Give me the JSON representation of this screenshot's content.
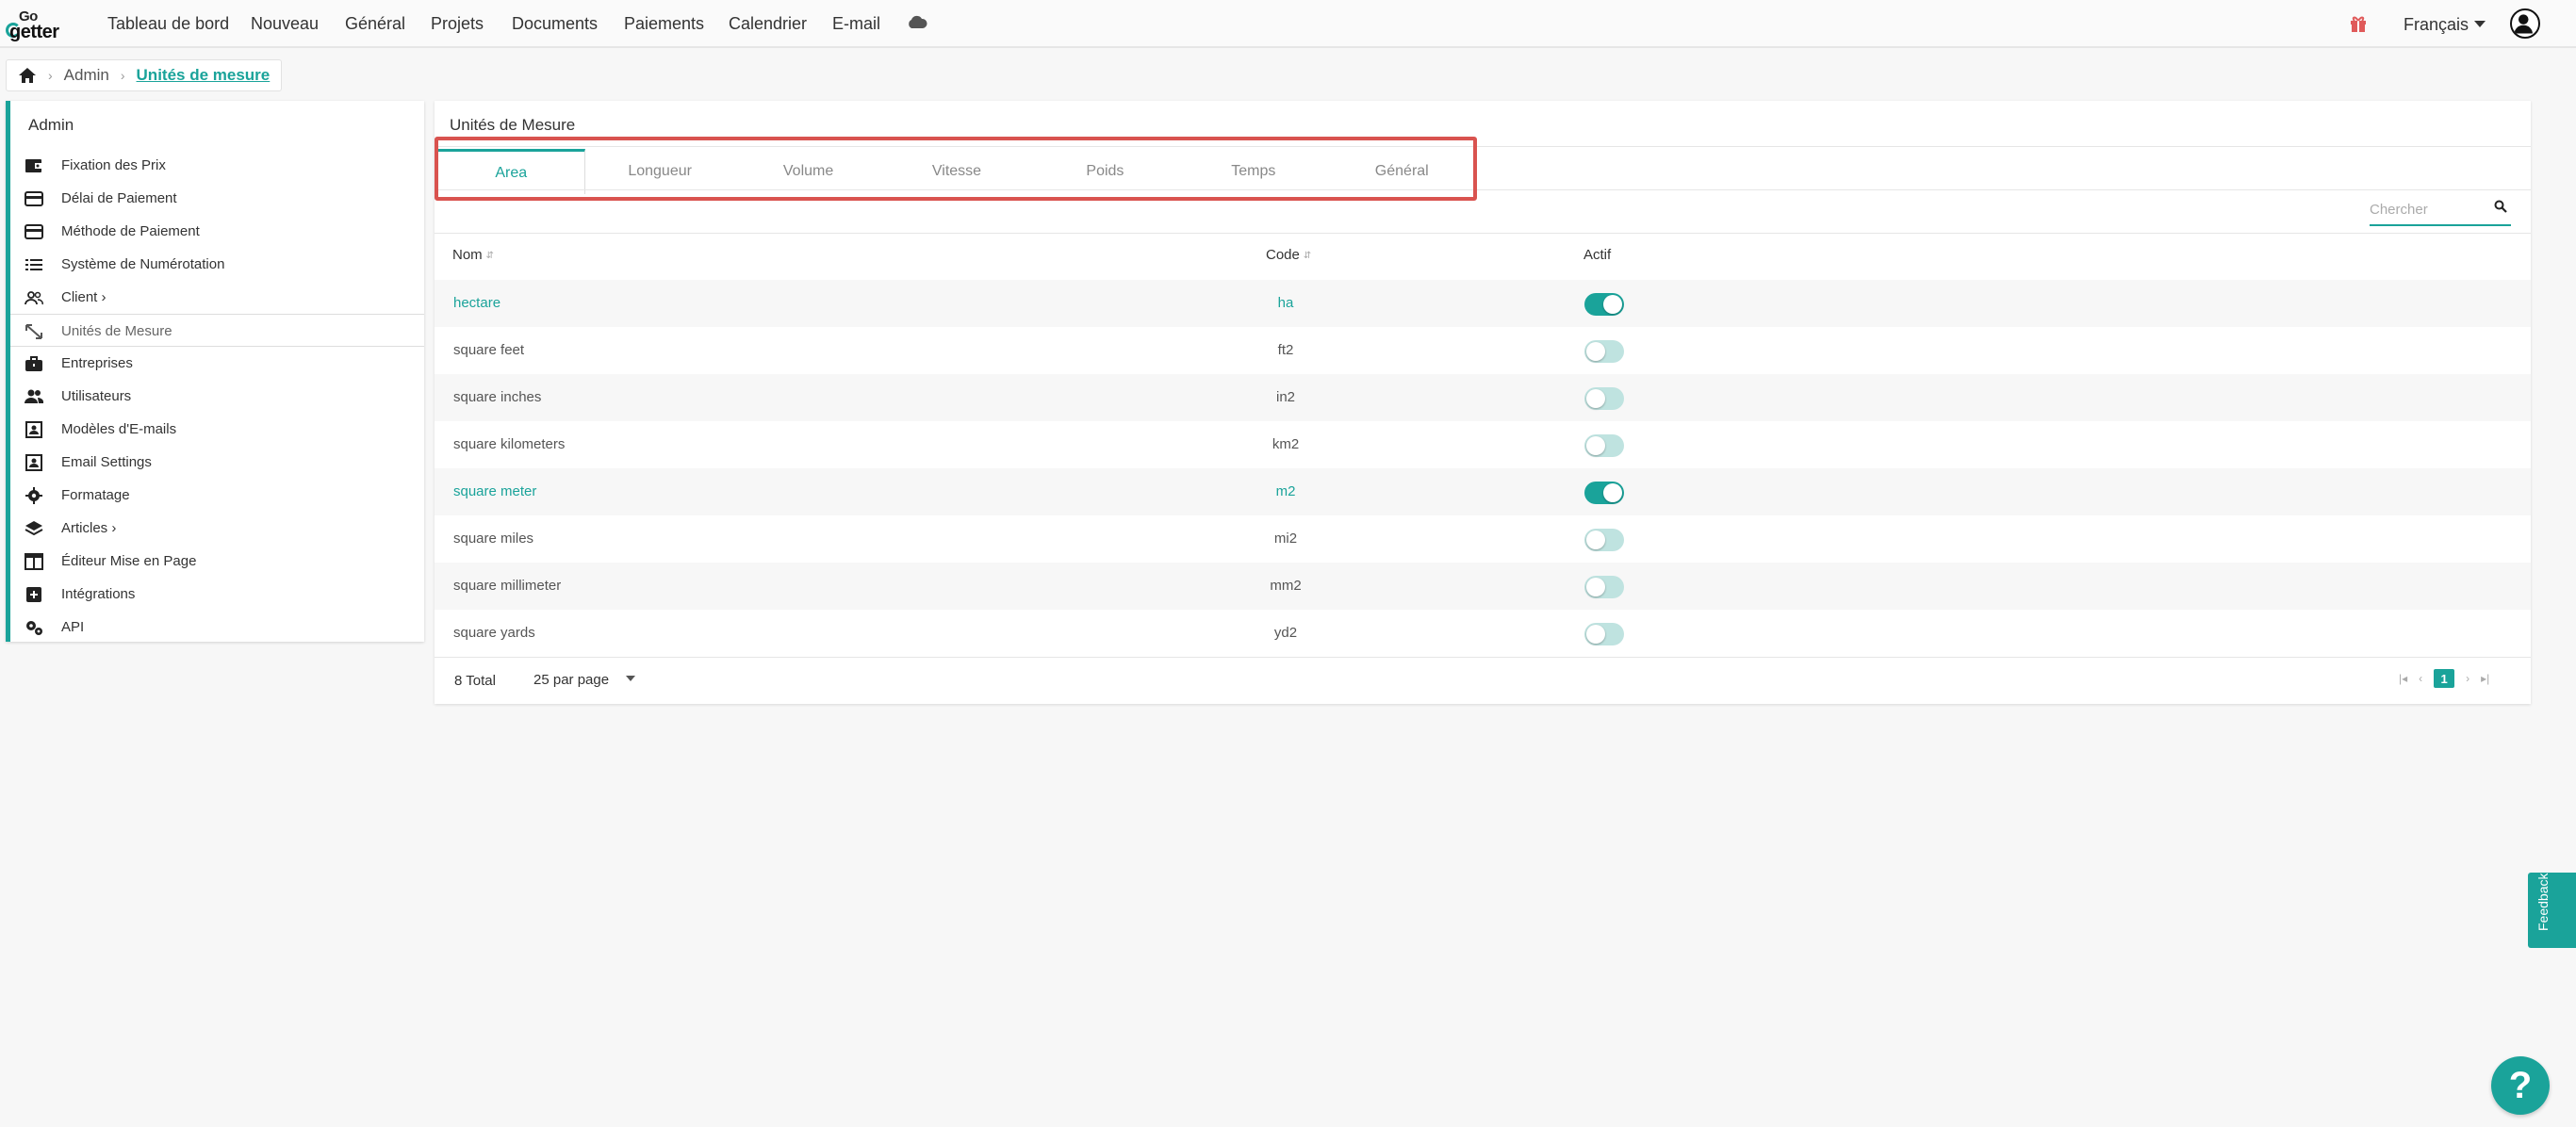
{
  "brand": {
    "logo_top": "Go",
    "logo_bottom": "getter",
    "accent": "#1aa39a",
    "highlight": "#d9534f"
  },
  "nav": {
    "items": [
      "Tableau de bord",
      "Nouveau",
      "Général",
      "Projets",
      "Documents",
      "Paiements",
      "Calendrier",
      "E-mail"
    ],
    "language": "Français"
  },
  "breadcrumb": {
    "admin": "Admin",
    "current": "Unités de mesure"
  },
  "sidebar": {
    "title": "Admin",
    "items": [
      {
        "label": "Fixation des Prix",
        "icon": "wallet-icon"
      },
      {
        "label": "Délai de Paiement",
        "icon": "credit-card-icon"
      },
      {
        "label": "Méthode de Paiement",
        "icon": "credit-card-icon"
      },
      {
        "label": "Système de Numérotation",
        "icon": "list-icon"
      },
      {
        "label": "Client",
        "icon": "users-icon"
      },
      {
        "label": "Unités de Mesure",
        "icon": "resize-icon"
      },
      {
        "label": "Entreprises",
        "icon": "briefcase-icon"
      },
      {
        "label": "Utilisateurs",
        "icon": "people-icon"
      },
      {
        "label": "Modèles d'E-mails",
        "icon": "email-template-icon"
      },
      {
        "label": "Email Settings",
        "icon": "email-template-icon"
      },
      {
        "label": "Formatage",
        "icon": "gear-icon"
      },
      {
        "label": "Articles",
        "icon": "layers-icon"
      },
      {
        "label": "Éditeur Mise en Page",
        "icon": "layout-icon"
      },
      {
        "label": "Intégrations",
        "icon": "plus-box-icon"
      },
      {
        "label": "API",
        "icon": "gears-icon"
      }
    ]
  },
  "main": {
    "title": "Unités de Mesure",
    "tabs": [
      "Area",
      "Longueur",
      "Volume",
      "Vitesse",
      "Poids",
      "Temps",
      "Général"
    ],
    "active_tab": "Area",
    "search_placeholder": "Chercher",
    "columns": {
      "name": "Nom",
      "code": "Code",
      "active": "Actif"
    },
    "rows": [
      {
        "name": "hectare",
        "code": "ha",
        "active": true
      },
      {
        "name": "square feet",
        "code": "ft2",
        "active": false
      },
      {
        "name": "square inches",
        "code": "in2",
        "active": false
      },
      {
        "name": "square kilometers",
        "code": "km2",
        "active": false
      },
      {
        "name": "square meter",
        "code": "m2",
        "active": true
      },
      {
        "name": "square miles",
        "code": "mi2",
        "active": false
      },
      {
        "name": "square millimeter",
        "code": "mm2",
        "active": false
      },
      {
        "name": "square yards",
        "code": "yd2",
        "active": false
      }
    ],
    "total": "8 Total",
    "per_page": "25 par page",
    "current_page": "1"
  },
  "feedback_label": "Feedback",
  "help_label": "?"
}
